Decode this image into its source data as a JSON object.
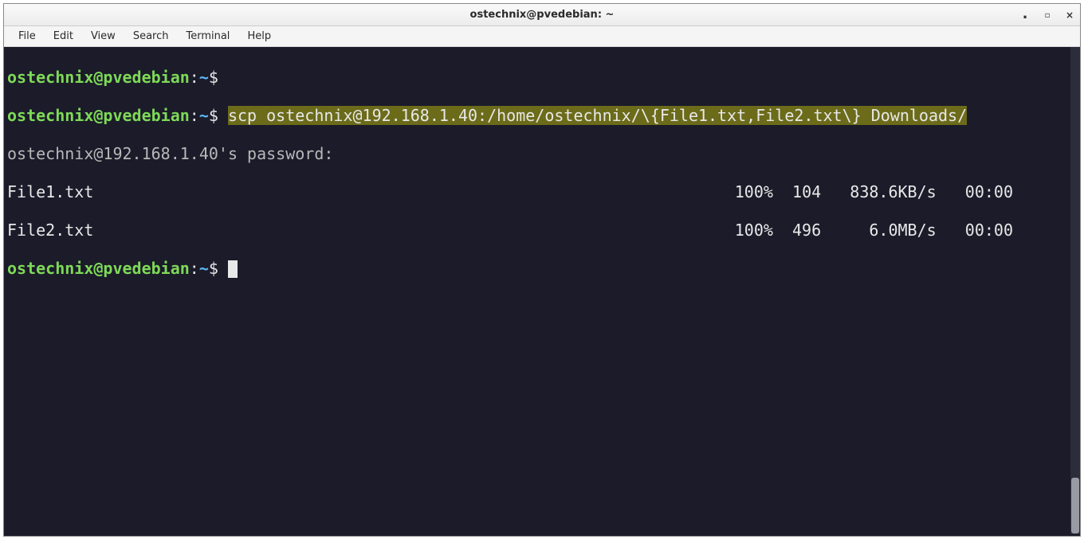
{
  "window": {
    "title": "ostechnix@pvedebian: ~"
  },
  "menu": {
    "file": "File",
    "edit": "Edit",
    "view": "View",
    "search": "Search",
    "terminal": "Terminal",
    "help": "Help"
  },
  "prompt": {
    "userhost": "ostechnix@pvedebian",
    "colon": ":",
    "path": "~",
    "dollar": "$"
  },
  "terminal": {
    "command": "scp ostechnix@192.168.1.40:/home/ostechnix/\\{File1.txt,File2.txt\\} Downloads/",
    "password_prompt": "ostechnix@192.168.1.40's password:",
    "transfers": [
      {
        "name": "File1.txt",
        "percent": "100%",
        "size": "104",
        "speed": "838.6KB/s",
        "eta": "00:00"
      },
      {
        "name": "File2.txt",
        "percent": "100%",
        "size": "496",
        "speed": "6.0MB/s",
        "eta": "00:00"
      }
    ]
  },
  "window_controls": {
    "min": "▪",
    "max": "□",
    "close": "×"
  }
}
